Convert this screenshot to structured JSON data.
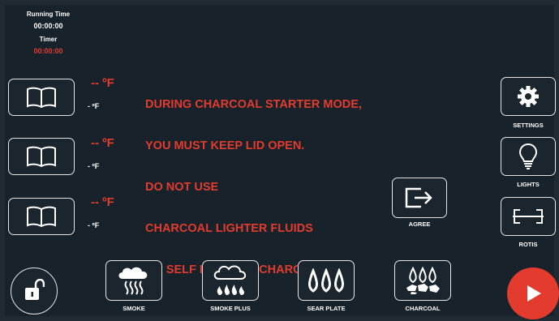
{
  "status": {
    "running_time_label": "Running Time",
    "running_time_value": "00:00:00",
    "timer_label": "Timer",
    "timer_value": "00:00:00"
  },
  "probes": [
    {
      "temp_primary": "-- ºF",
      "temp_secondary": "- ºF"
    },
    {
      "temp_primary": "-- ºF",
      "temp_secondary": "- ºF"
    },
    {
      "temp_primary": "-- ºF",
      "temp_secondary": "- ºF"
    }
  ],
  "warning": {
    "lines": [
      "DURING CHARCOAL STARTER MODE,",
      "YOU MUST KEEP LID OPEN.",
      "DO NOT USE",
      "CHARCOAL LIGHTER FLUIDS",
      "OR SELF LIGHTING CHARCOAL"
    ]
  },
  "agree": {
    "label": "AGREE",
    "icon": "exit-arrow-icon"
  },
  "side": {
    "settings_label": "SETTINGS",
    "lights_label": "LIGHTS",
    "rotis_label": "ROTIS"
  },
  "modes": [
    {
      "label": "SMOKE",
      "icon": "smoke-icon"
    },
    {
      "label": "SMOKE PLUS",
      "icon": "smoke-plus-icon"
    },
    {
      "label": "SEAR PLATE",
      "icon": "flame-icon"
    },
    {
      "label": "CHARCOAL",
      "icon": "charcoal-icon"
    }
  ],
  "colors": {
    "background": "#17222b",
    "accent_red": "#e33b2e",
    "border": "#e6e6e6"
  }
}
